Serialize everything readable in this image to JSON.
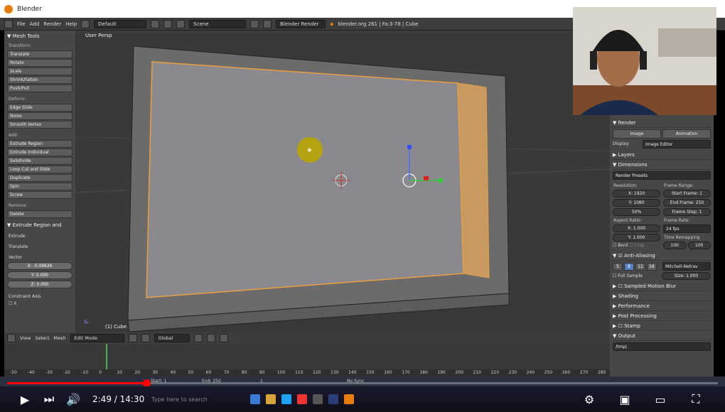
{
  "window": {
    "title": "Blender"
  },
  "topbar": {
    "menus": [
      "File",
      "Add",
      "Render",
      "Help"
    ],
    "layout": "Default",
    "scene": "Scene",
    "engine": "Blender Render",
    "stats": "blender.org 261 | Fa:3-78 | Cube"
  },
  "toolshelf": {
    "header": "Mesh Tools",
    "transform_label": "Transform:",
    "transform": [
      "Translate",
      "Rotate",
      "Scale",
      "Shrink/Fatten",
      "Push/Pull"
    ],
    "deform_label": "Deform:",
    "deform": [
      "Edge Slide",
      "Noise",
      "Smooth Vertex"
    ],
    "add_label": "Add:",
    "add": [
      "Extrude Region",
      "Extrude Individual",
      "Subdivide",
      "Loop Cut and Slide",
      "Duplicate",
      "Spin",
      "Screw"
    ],
    "remove_label": "Remove:",
    "remove": [
      "Delete"
    ],
    "op_header": "Extrude Region and",
    "op_items": [
      "Extrude",
      "Translate"
    ],
    "vector_label": "Vector",
    "vector": [
      "X: -0.09626",
      "Y: 0.000",
      "Z: 0.000"
    ],
    "constraint_label": "Constraint Axis",
    "constraint": [
      "X"
    ]
  },
  "viewport": {
    "view_label": "User Persp",
    "object_label": "(1) Cube"
  },
  "properties": {
    "render_header": "Render",
    "image_btn": "Image",
    "animation_btn": "Animation",
    "display_label": "Display:",
    "display_value": "Image Editor",
    "layers": "Layers",
    "dimensions": "Dimensions",
    "presets": "Render Presets",
    "resolution_label": "Resolution:",
    "res_x": "X: 1920",
    "res_y": "Y: 1080",
    "res_pct": "50%",
    "frame_range_label": "Frame Range:",
    "start_frame": "Start Frame: 1",
    "end_frame": "End Frame: 250",
    "frame_step": "Frame Step: 1",
    "aspect_label": "Aspect Ratio:",
    "aspect_x": "X: 1.000",
    "aspect_y": "Y: 1.000",
    "frame_rate_label": "Frame Rate:",
    "frame_rate": "24 fps",
    "time_remap_label": "Time Remapping",
    "remap_old": "100",
    "remap_new": "100",
    "bord": "Bord",
    "crop": "Crop",
    "aa_header": "Anti-Aliasing",
    "aa_samples": [
      "5",
      "8",
      "11",
      "16"
    ],
    "aa_filter": "Mitchell-Netrav",
    "full_sample": "Full Sample",
    "size": "Size: 1.000",
    "sampled_motion_blur": "Sampled Motion Blur",
    "shading": "Shading",
    "performance": "Performance",
    "post_processing": "Post Processing",
    "stamp": "Stamp",
    "output": "Output",
    "output_path": "/tmp\\"
  },
  "timeline": {
    "menus": [
      "View",
      "Select",
      "Mesh"
    ],
    "mode": "Edit Mode",
    "orientation": "Global",
    "start": "Start: 1",
    "end": "End: 250",
    "frame": "1",
    "sync": "No Sync",
    "ticks": [
      "-50",
      "-40",
      "-30",
      "-20",
      "-10",
      "0",
      "10",
      "20",
      "30",
      "40",
      "50",
      "60",
      "70",
      "80",
      "90",
      "100",
      "110",
      "120",
      "130",
      "140",
      "150",
      "160",
      "170",
      "180",
      "190",
      "200",
      "210",
      "220",
      "230",
      "240",
      "250",
      "260",
      "270",
      "280"
    ]
  },
  "player": {
    "time": "2:49 / 14:30",
    "progress": 0.196,
    "taskbar_hint": "Type here to search"
  }
}
